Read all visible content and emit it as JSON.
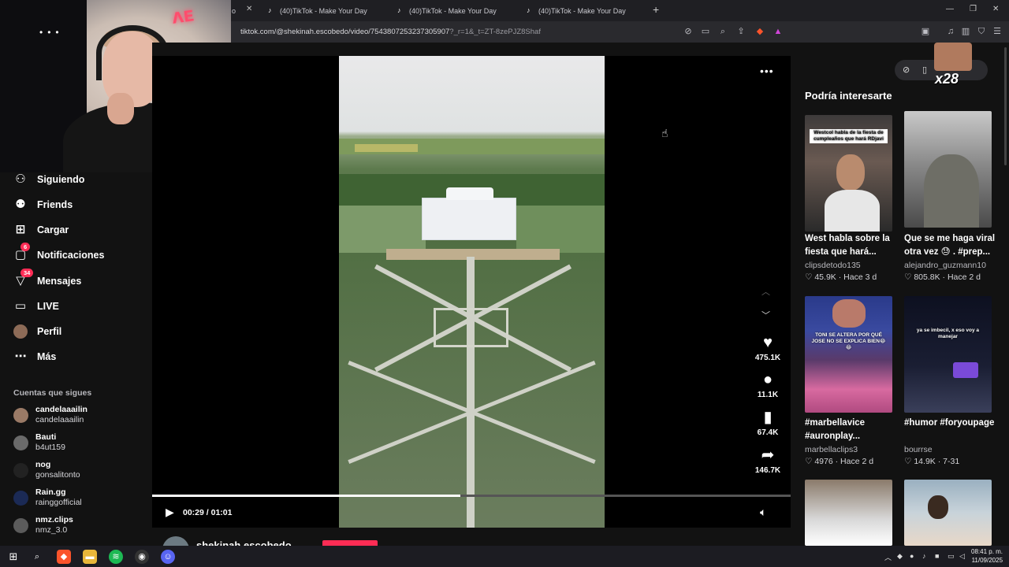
{
  "browser": {
    "tabs": [
      {
        "label": "(40)TikTok - Make Your Day"
      },
      {
        "label": "(40)TikTok - Make Your Day"
      },
      {
        "label": "(40)TikTok - Make Your Day"
      }
    ],
    "partial_tab_label": "o",
    "url_main": "tiktok.com/@shekinah.escobedo/video/7543807253237305907",
    "url_query": "_r=1&_t=ZT-8zePJZ8Shaf"
  },
  "sidebar": {
    "items": [
      {
        "label": "Siguiendo",
        "icon": "following-icon"
      },
      {
        "label": "Friends",
        "icon": "friends-icon"
      },
      {
        "label": "Cargar",
        "icon": "upload-icon"
      },
      {
        "label": "Notificaciones",
        "icon": "inbox-icon",
        "badge": "6"
      },
      {
        "label": "Mensajes",
        "icon": "messages-icon",
        "badge": "34"
      },
      {
        "label": "LIVE",
        "icon": "live-icon"
      },
      {
        "label": "Perfil",
        "icon": "profile-avatar"
      },
      {
        "label": "Más",
        "icon": "more-icon"
      }
    ],
    "following_title": "Cuentas que sigues",
    "following": [
      {
        "name": "candelaaailin",
        "handle": "candelaaailin"
      },
      {
        "name": "Bauti",
        "handle": "b4ut159"
      },
      {
        "name": "nog",
        "handle": "gonsalitonto"
      },
      {
        "name": "Rain.gg",
        "handle": "rainggofficial"
      },
      {
        "name": "nmz.clips",
        "handle": "nmz_3.0"
      }
    ]
  },
  "player": {
    "likes": "475.1K",
    "comments": "11.1K",
    "saves": "67.4K",
    "shares": "146.7K",
    "time": "00:29 / 01:01",
    "progress": 0.483,
    "author": "shekinah.escobedo"
  },
  "recommendations": {
    "title": "Podría interesarte",
    "overlay_text": "x28",
    "cards": [
      {
        "title": "West habla sobre la fiesta que hará...",
        "user": "clipsdetodo135",
        "likes": "45.9K",
        "age": "Hace 3 d",
        "caption": "Westcol habla de la fiesta de cumpleaños que hará RDjavi"
      },
      {
        "title": "Que se me haga viral otra vez 😓 . #prep...",
        "user": "alejandro_guzmann10",
        "likes": "805.8K",
        "age": "Hace 2 d",
        "caption": ""
      },
      {
        "title": "#marbellavice #auronplay...",
        "user": "marbellaclips3",
        "likes": "4976",
        "age": "Hace 2 d",
        "caption": "TONI SE ALTERA POR QUÉ JOSE NO SE EXPLICA BIEN😂😂"
      },
      {
        "title": "#humor #foryoupage",
        "user": "bourrse",
        "likes": "14.9K",
        "age": "7-31",
        "caption": "ya se imbecil, x eso voy a manejar"
      }
    ]
  },
  "taskbar": {
    "time": "08:41 p. m.",
    "date": "11/09/2025"
  }
}
